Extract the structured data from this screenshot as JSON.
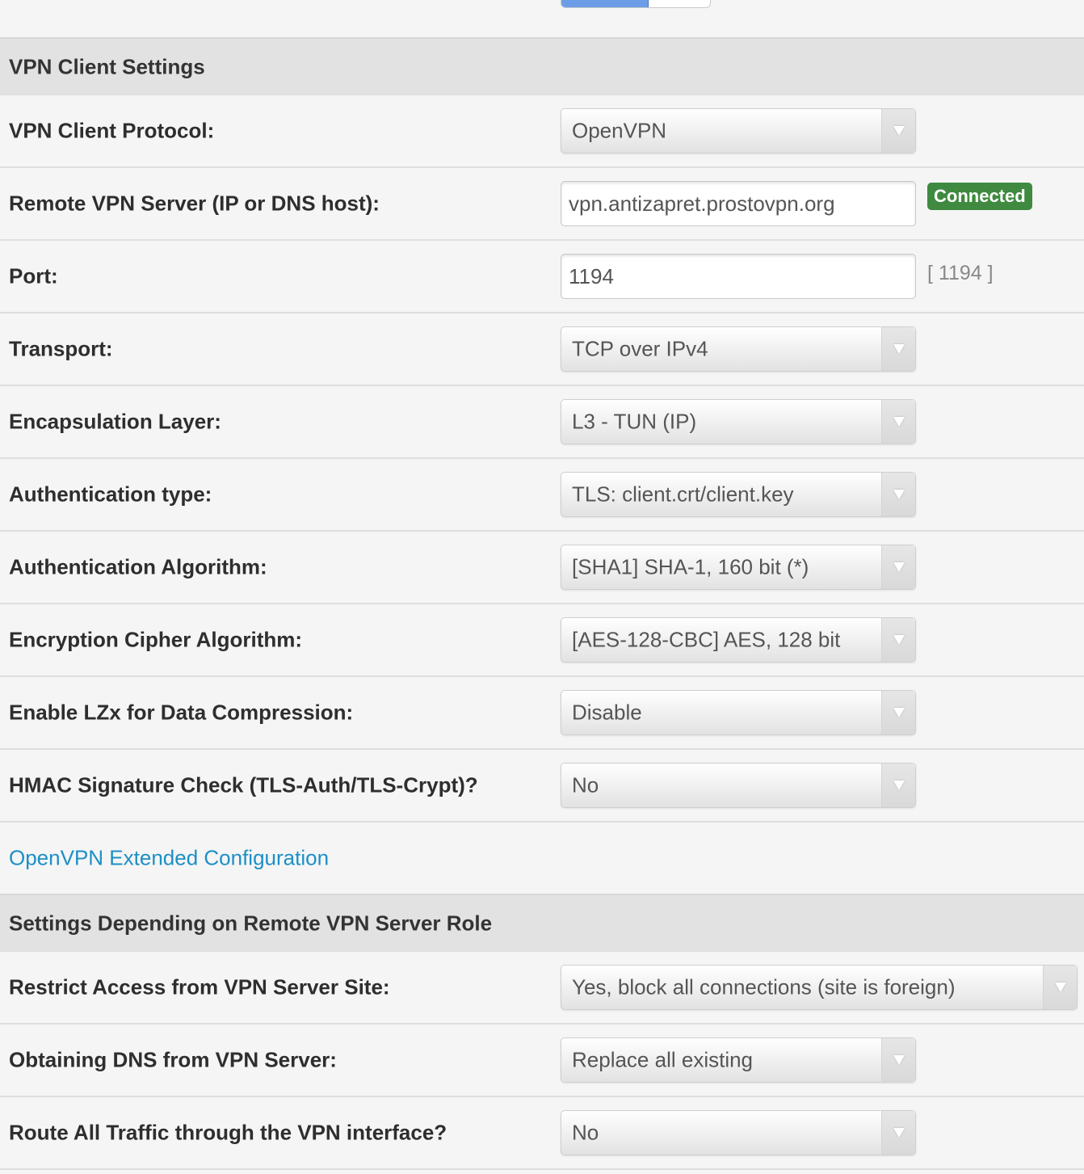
{
  "top_toggle": {
    "state": "on"
  },
  "sections": {
    "client": {
      "title": "VPN Client Settings"
    },
    "role": {
      "title": "Settings Depending on Remote VPN Server Role"
    }
  },
  "rows": {
    "protocol": {
      "label": "VPN Client Protocol:",
      "value": "OpenVPN"
    },
    "server": {
      "label": "Remote VPN Server (IP or DNS host):",
      "value": "vpn.antizapret.prostovpn.org",
      "status": "Connected"
    },
    "port": {
      "label": "Port:",
      "value": "1194",
      "default_hint": "[ 1194 ]"
    },
    "transport": {
      "label": "Transport:",
      "value": "TCP over IPv4"
    },
    "encapsulation": {
      "label": "Encapsulation Layer:",
      "value": "L3 - TUN (IP)"
    },
    "auth_type": {
      "label": "Authentication type:",
      "value": "TLS: client.crt/client.key"
    },
    "auth_alg": {
      "label": "Authentication Algorithm:",
      "value": "[SHA1] SHA-1, 160 bit (*)"
    },
    "cipher": {
      "label": "Encryption Cipher Algorithm:",
      "value": "[AES-128-CBC] AES, 128 bit"
    },
    "lzx": {
      "label": "Enable LZx for Data Compression:",
      "value": "Disable"
    },
    "hmac": {
      "label": "HMAC Signature Check (TLS-Auth/TLS-Crypt)?",
      "value": "No"
    },
    "restrict": {
      "label": "Restrict Access from VPN Server Site:",
      "value": "Yes, block all connections (site is foreign)"
    },
    "dns": {
      "label": "Obtaining DNS from VPN Server:",
      "value": "Replace all existing"
    },
    "route_all": {
      "label": "Route All Traffic through the VPN interface?",
      "value": "No"
    }
  },
  "links": {
    "extended_config": "OpenVPN Extended Configuration"
  },
  "colors": {
    "badge_connected": "#3f8a40",
    "link": "#1c8fc6",
    "section_bg": "#e2e2e2",
    "toggle_on": "#6c9ee8"
  }
}
